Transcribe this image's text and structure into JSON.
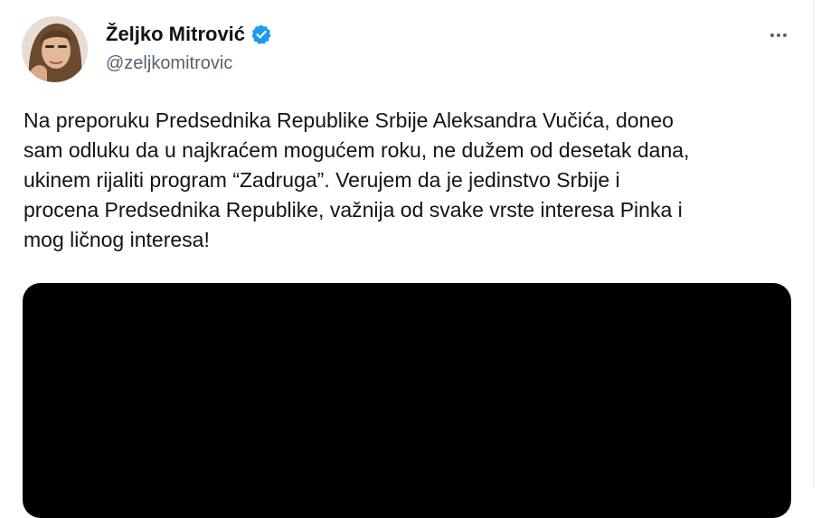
{
  "author": {
    "display_name": "Željko Mitrović",
    "handle": "@zeljkomitrovic",
    "verified": true,
    "avatar_icon": "profile-avatar"
  },
  "tweet": {
    "text": "Na preporuku Predsednika Republike Srbije Aleksandra Vučića, doneo\nsam odluku da u najkraćem mogućem roku, ne dužem od desetak dana,\nukinem rijaliti program “Zadruga”. Verujem da je jedinstvo Srbije i\nprocena Predsednika Republike, važnija od svake vrste interesa Pinka i\nmog ličnog interesa!"
  },
  "icons": {
    "verified": "verified-badge-icon",
    "more": "more-options-icon"
  },
  "colors": {
    "text_primary": "#0f1419",
    "text_secondary": "#536471",
    "verified_blue": "#1d9bf0",
    "media_background": "#000000"
  }
}
